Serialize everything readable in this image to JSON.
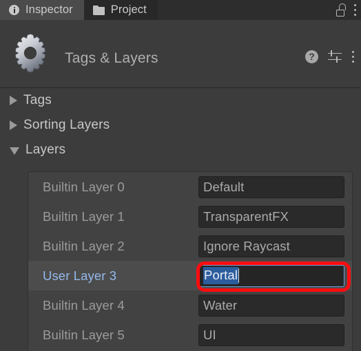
{
  "window": {
    "tabs": [
      {
        "label": "Inspector",
        "icon": "info-circle-icon",
        "active": true
      },
      {
        "label": "Project",
        "icon": "folder-icon",
        "active": false
      }
    ],
    "lock_icon": "unlocked-padlock-icon",
    "tabbar_menu_icon": "kebab-menu-icon"
  },
  "header": {
    "icon": "gear-icon",
    "title": "Tags & Layers",
    "help_icon": "help-question-icon",
    "preset_icon": "preset-settings-icon",
    "menu_icon": "kebab-menu-icon"
  },
  "foldouts": [
    {
      "label": "Tags",
      "expanded": false
    },
    {
      "label": "Sorting Layers",
      "expanded": false
    },
    {
      "label": "Layers",
      "expanded": true
    }
  ],
  "layers": [
    {
      "label": "Builtin Layer 0",
      "value": "Default",
      "selected": false,
      "editing": false
    },
    {
      "label": "Builtin Layer 1",
      "value": "TransparentFX",
      "selected": false,
      "editing": false
    },
    {
      "label": "Builtin Layer 2",
      "value": "Ignore Raycast",
      "selected": false,
      "editing": false
    },
    {
      "label": "User Layer 3",
      "value": "Portal",
      "selected": true,
      "editing": true
    },
    {
      "label": "Builtin Layer 4",
      "value": "Water",
      "selected": false,
      "editing": false
    },
    {
      "label": "Builtin Layer 5",
      "value": "UI",
      "selected": false,
      "editing": false
    }
  ],
  "annotation": {
    "shape": "rounded-rectangle",
    "color": "#fb0d11",
    "targets": "layers.3.value"
  },
  "colors": {
    "panel_background": "#3c3c3c",
    "tabbar_background": "#1e1e1e",
    "active_tab": "#4b4b4b",
    "inactive_tab": "#282828",
    "list_background": "#424242",
    "selected_row": "#4c4c4c",
    "selected_label_text": "#93b9ec",
    "field_background": "#2a2a2a",
    "field_focus_border": "#6f9fd8",
    "text_selection": "#2c5d9e",
    "annotation_red": "#fb0d11"
  }
}
